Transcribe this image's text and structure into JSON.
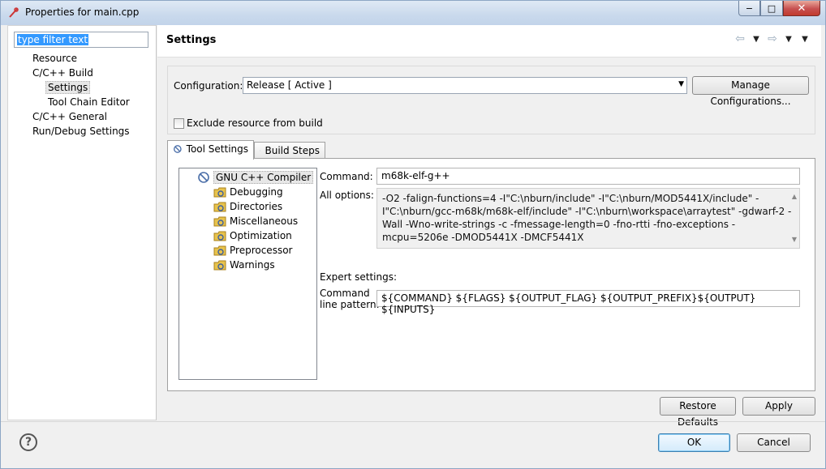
{
  "window": {
    "title": "Properties for main.cpp",
    "minimize": "−",
    "maximize": "□",
    "close": "✕"
  },
  "sidebar": {
    "filter_placeholder": "type filter text",
    "items": [
      "Resource",
      "C/C++ Build",
      "Settings",
      "Tool Chain Editor",
      "C/C++ General",
      "Run/Debug Settings"
    ]
  },
  "header": {
    "title": "Settings",
    "back": "⇦",
    "forward": "⇨",
    "dropdown": "▼",
    "menu": "▼"
  },
  "configuration": {
    "label": "Configuration:",
    "value": "Release  [ Active ]",
    "manage_button": "Manage Configurations...",
    "exclude_label": "Exclude resource from build"
  },
  "tabs": [
    "Tool Settings",
    "Build Steps"
  ],
  "tree": {
    "root": "GNU C++ Compiler",
    "children": [
      "Debugging",
      "Directories",
      "Miscellaneous",
      "Optimization",
      "Preprocessor",
      "Warnings"
    ]
  },
  "tool": {
    "command_label": "Command:",
    "command_value": "m68k-elf-g++",
    "all_options_label": "All options:",
    "all_options_value": "-O2 -falign-functions=4 -I\"C:\\nburn/include\" -I\"C:\\nburn/MOD5441X/include\" -I\"C:\\nburn/gcc-m68k/m68k-elf/include\" -I\"C:\\nburn\\workspace\\arraytest\" -gdwarf-2 -Wall -Wno-write-strings -c -fmessage-length=0 -fno-rtti -fno-exceptions -mcpu=5206e -DMOD5441X -DMCF5441X",
    "expert_label": "Expert settings:",
    "pattern_label_1": "Command",
    "pattern_label_2": "line pattern:",
    "pattern_value": "${COMMAND} ${FLAGS} ${OUTPUT_FLAG} ${OUTPUT_PREFIX}${OUTPUT} ${INPUTS}"
  },
  "buttons": {
    "restore": "Restore Defaults",
    "apply": "Apply",
    "ok": "OK",
    "cancel": "Cancel",
    "help": "?"
  }
}
